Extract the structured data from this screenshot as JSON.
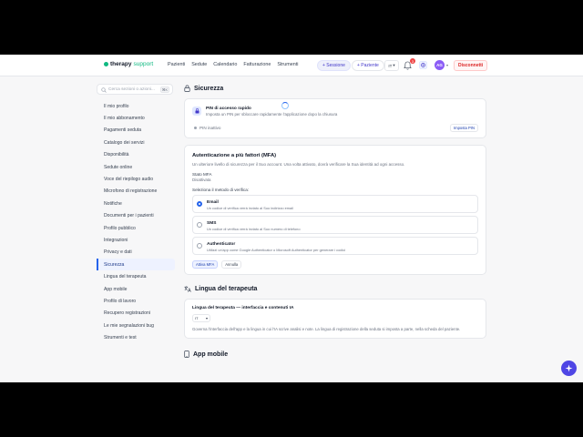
{
  "brand": {
    "name_bold": "therapy",
    "name_light": "support",
    "accent": "#10b981"
  },
  "nav": [
    "Pazienti",
    "Sedute",
    "Calendario",
    "Fatturazione",
    "Strumenti"
  ],
  "header_actions": {
    "session_label": "+ Sessione",
    "patient_label": "+ Paziente",
    "language": "IT",
    "notifications_count": "3",
    "avatar_initials": "AG",
    "disconnect_label": "Disconnetti"
  },
  "sidebar": {
    "search_placeholder": "Cerca sezioni o azioni...",
    "search_shortcut": "⌘K",
    "items": [
      "Il mio profilo",
      "Il mio abbonamento",
      "Pagamenti seduta",
      "Catalogo dei servizi",
      "Disponibilità",
      "Sedute online",
      "Voce del riepilogo audio",
      "Microfono di registrazione",
      "Notifiche",
      "Documenti per i pazienti",
      "Profilo pubblico",
      "Integrazioni",
      "Privacy e dati",
      "Sicurezza",
      "Lingua del terapeuta",
      "App mobile",
      "Profilo di lavoro",
      "Recupero registrazioni",
      "Le mie segnalazioni bug",
      "Strumenti e test"
    ],
    "active": "Sicurezza"
  },
  "security": {
    "title": "Sicurezza",
    "pin": {
      "title": "PIN di accesso rapido",
      "description": "Imposta un PIN per sbloccare rapidamente l'applicazione dopo la chiusura",
      "status": "PIN inattivo",
      "button": "Imposta PIN"
    },
    "mfa": {
      "title": "Autenticazione a più fattori (MFA)",
      "description": "Un ulteriore livello di sicurezza per il Suo account. Una volta attivato, dovrà verificare la Sua identità ad ogni accesso.",
      "status_label": "Stato MFA",
      "status_value": "Disattivata",
      "method_label": "Seleziona il metodo di verifica:",
      "options": [
        {
          "title": "Email",
          "desc": "Un codice di verifica verrà inviato al Suo indirizzo email",
          "selected": true
        },
        {
          "title": "SMS",
          "desc": "Un codice di verifica verrà inviato al Suo numero di telefono",
          "selected": false
        },
        {
          "title": "Authenticator",
          "desc": "Utilizzi un'app come Google Authenticator o Microsoft Authenticator per generare i codici",
          "selected": false
        }
      ],
      "activate_button": "Attiva MFA",
      "cancel_button": "Annulla"
    }
  },
  "therapist_language": {
    "title": "Lingua del terapeuta",
    "field_label": "Lingua del terapeuta — interfaccia e contenuti IA",
    "selected": "IT",
    "description": "Governa l'interfaccia dell'app e la lingua in cui l'IA scrive analisi e note. La lingua di registrazione della seduta si imposta a parte, nella scheda del paziente."
  },
  "mobile_app": {
    "title": "App mobile"
  }
}
